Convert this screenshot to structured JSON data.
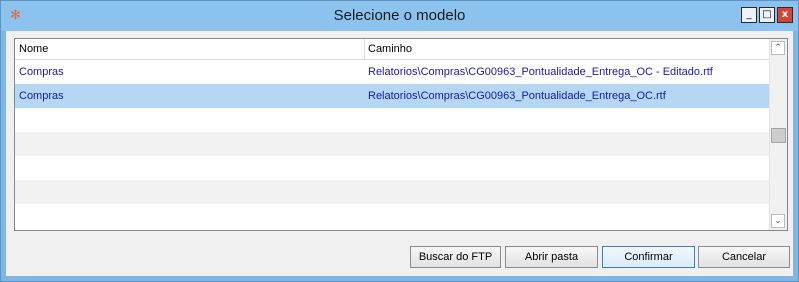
{
  "window": {
    "title": "Selecione o modelo",
    "minimize": "_",
    "maximize": "□",
    "close": "x"
  },
  "table": {
    "columns": [
      "Nome",
      "Caminho"
    ],
    "rows": [
      {
        "nome": "Compras",
        "caminho": "Relatorios\\Compras\\CG00963_Pontualidade_Entrega_OC - Editado.rtf",
        "selected": false
      },
      {
        "nome": "Compras",
        "caminho": "Relatorios\\Compras\\CG00963_Pontualidade_Entrega_OC.rtf",
        "selected": true
      }
    ]
  },
  "buttons": {
    "buscar_ftp": "Buscar do FTP",
    "abrir_pasta": "Abrir pasta",
    "confirmar": "Confirmar",
    "cancelar": "Cancelar"
  },
  "icons": {
    "app": "app-logo-icon",
    "scroll_up": "chevron-up-icon",
    "scroll_down": "chevron-down-icon"
  },
  "colors": {
    "titlebar": "#8cc2ee",
    "selection": "#b4d7f4",
    "link_text": "#1a1aa6",
    "close_button": "#d24638"
  }
}
